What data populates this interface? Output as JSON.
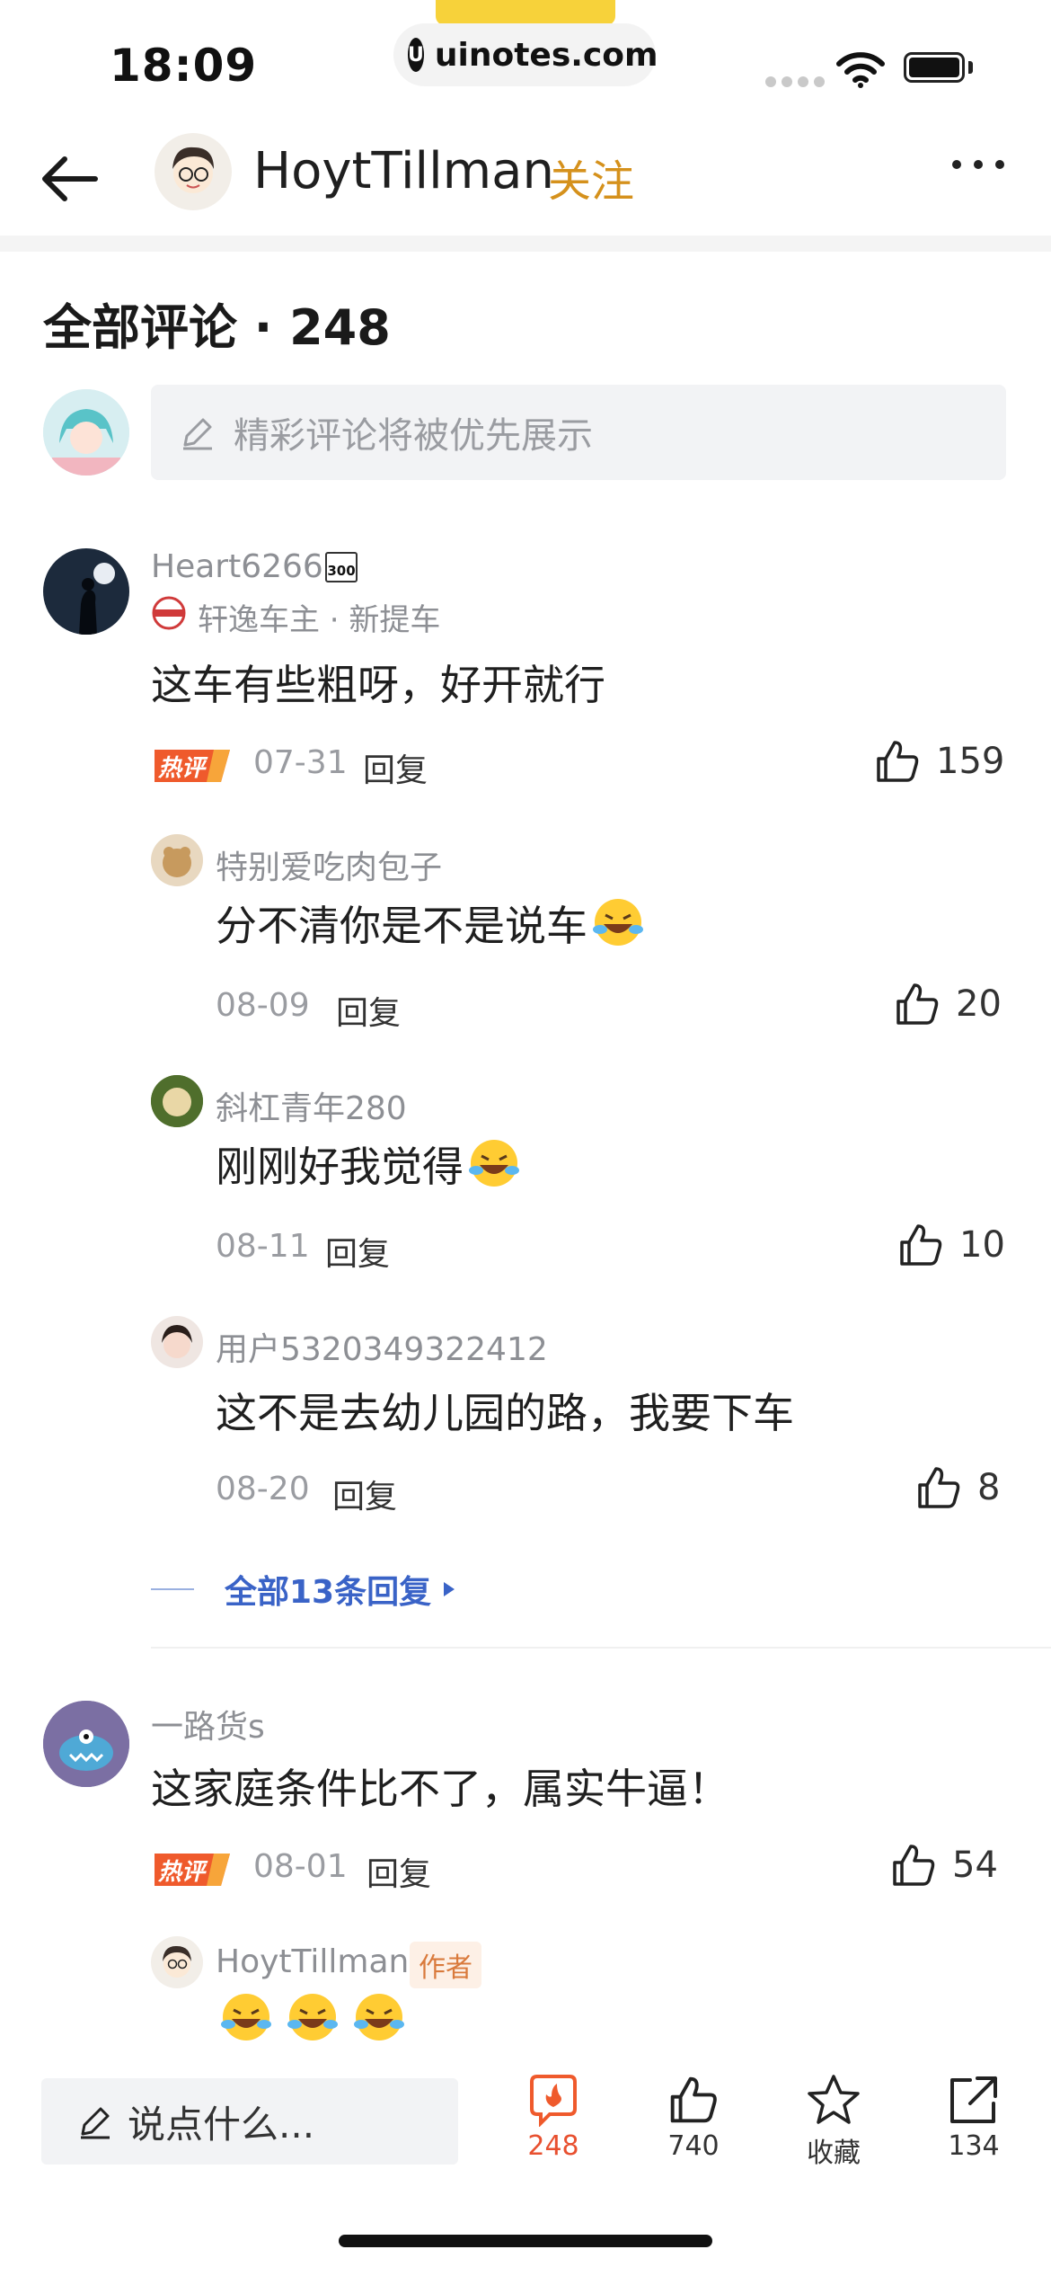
{
  "status_bar": {
    "time": "18:09",
    "watermark": "uinotes.com"
  },
  "header": {
    "username": "HoytTillman",
    "follow_label": "关注"
  },
  "comments_section": {
    "title": "全部评论 · 248",
    "input_placeholder": "精彩评论将被优先展示"
  },
  "comments": [
    {
      "user": "Heart6266",
      "level_badge": "300",
      "owner_info": "轩逸车主 · 新提车",
      "text": "这车有些粗呀，好开就行",
      "hot": true,
      "date": "07-31",
      "reply_label": "回复",
      "likes": "159",
      "replies": [
        {
          "user": "特别爱吃肉包子",
          "text": "分不清你是不是说车",
          "date": "08-09",
          "reply_label": "回复",
          "likes": "20"
        },
        {
          "user": "斜杠青年280",
          "text": "刚刚好我觉得",
          "date": "08-11",
          "reply_label": "回复",
          "likes": "10"
        },
        {
          "user": "用户5320349322412",
          "text": "这不是去幼儿园的路，我要下车",
          "date": "08-20",
          "reply_label": "回复",
          "likes": "8"
        }
      ],
      "see_all_label": "全部13条回复"
    },
    {
      "user": "一路货s",
      "text": "这家庭条件比不了，属实牛逼！",
      "hot": true,
      "date": "08-01",
      "reply_label": "回复",
      "likes": "54",
      "replies": [
        {
          "user": "HoytTillman",
          "tag": "作者"
        }
      ]
    }
  ],
  "hot_badge_label": "热评",
  "bottom_bar": {
    "input_placeholder": "说点什么...",
    "comments_count": "248",
    "likes_count": "740",
    "favorite_label": "收藏",
    "share_count": "134"
  },
  "colors": {
    "accent": "#d5911c",
    "link": "#3a63c7",
    "hot": "#e8502f"
  }
}
